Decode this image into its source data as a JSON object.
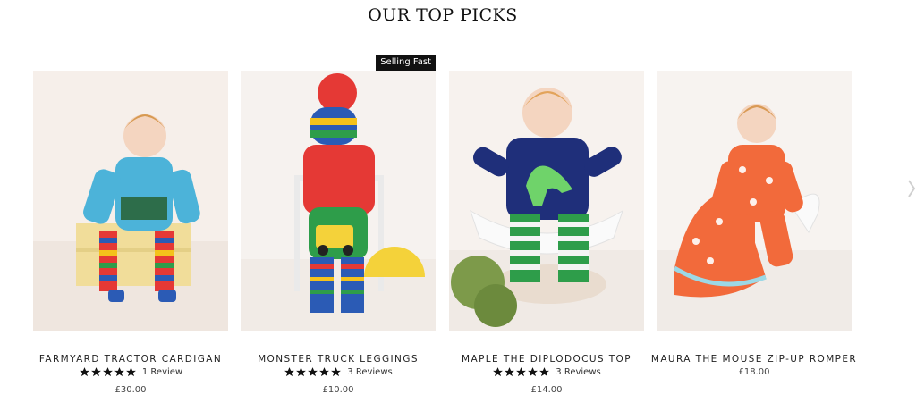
{
  "section": {
    "title": "OUR TOP PICKS"
  },
  "products": [
    {
      "name": "FARMYARD TRACTOR CARDIGAN",
      "rating": 5,
      "reviews": "1 Review",
      "price": "£30.00",
      "badge": ""
    },
    {
      "name": "MONSTER TRUCK LEGGINGS",
      "rating": 5,
      "reviews": "3 Reviews",
      "price": "£10.00",
      "badge": "Selling Fast"
    },
    {
      "name": "MAPLE THE DIPLODOCUS TOP",
      "rating": 5,
      "reviews": "3 Reviews",
      "price": "£14.00",
      "badge": ""
    },
    {
      "name": "MAURA THE MOUSE ZIP-UP ROMPER",
      "rating": null,
      "reviews": "",
      "price": "£18.00",
      "badge": ""
    }
  ],
  "icons": {
    "star": "star-icon"
  },
  "colors": {
    "badge_bg": "#111111",
    "star": "#111111"
  }
}
